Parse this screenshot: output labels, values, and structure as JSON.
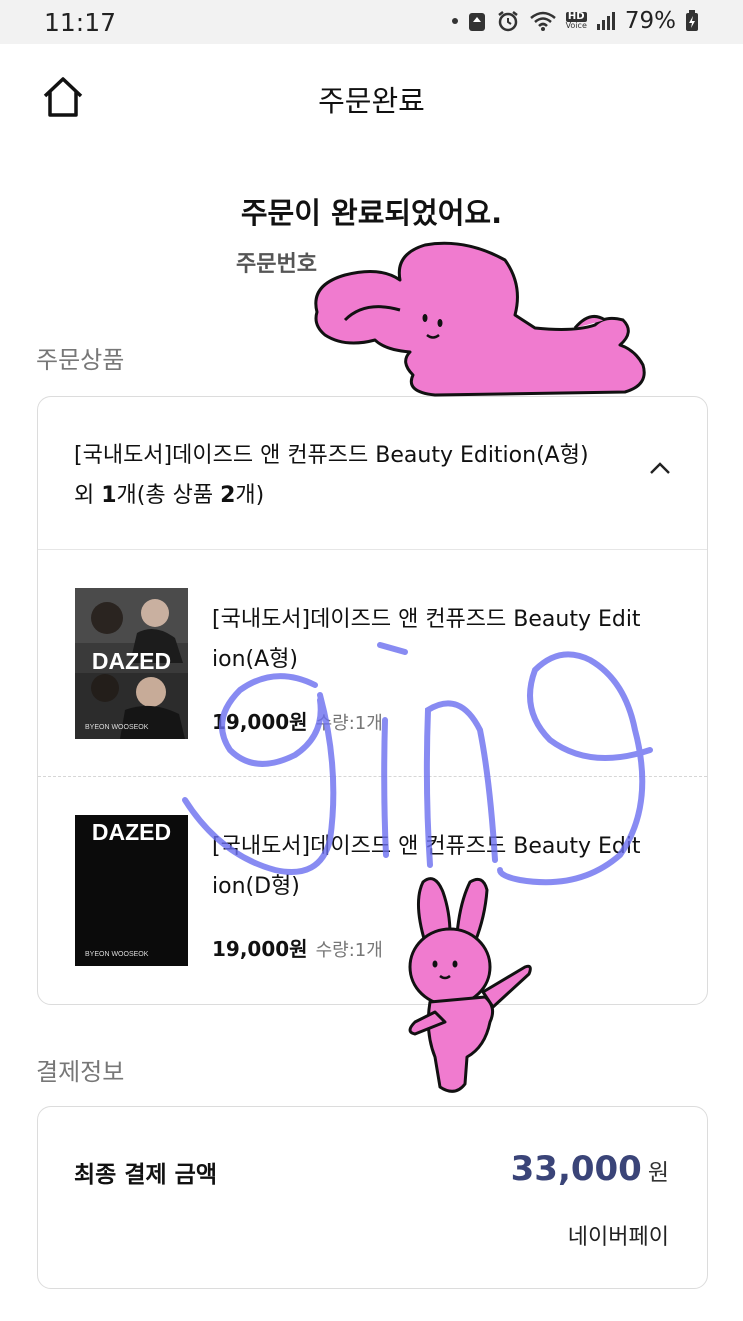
{
  "status_bar": {
    "time": "11:17",
    "hd_label": "HD",
    "voice_label": "Voice",
    "battery": "79%"
  },
  "header": {
    "title": "주문완료"
  },
  "complete": {
    "title": "주문이 완료되었어요.",
    "order_number_label": "주문번호 "
  },
  "products": {
    "section_label": "주문상품",
    "summary_title": "[국내도서]데이즈드 앤 컨퓨즈드 Beauty Edition(A형)",
    "summary_prefix": "외 ",
    "summary_extra_count": "1",
    "summary_mid": "개(총 상품 ",
    "summary_total_count": "2",
    "summary_suffix": "개)",
    "items": [
      {
        "title_line1": "[국내도서]데이즈드 앤 컨퓨즈드 Beauty Edit",
        "title_line2": "ion(A형)",
        "price": "19,000원",
        "qty": "수량:1개",
        "cover_word": "DAZED",
        "cover_small": "BYEON WOOSEOK"
      },
      {
        "title_line1": "[국내도서]데이즈드 앤 컨퓨즈드 Beauty Edit",
        "title_line2": "ion(D형)",
        "price": "19,000원",
        "qty": "수량:1개",
        "cover_word": "DAZED",
        "cover_small": "BYEON WOOSEOK"
      }
    ]
  },
  "payment": {
    "section_label": "결제정보",
    "final_label": "최종 결제 금액",
    "amount": "33,000",
    "unit": "원",
    "method": "네이버페이"
  },
  "colors": {
    "amount": "#3a4478",
    "sticker_pink": "#f07bcf",
    "scribble": "#6b6ff0"
  },
  "icons": [
    "home-icon",
    "chevron-up-icon",
    "wifi-icon",
    "signal-icon",
    "battery-icon",
    "alarm-icon"
  ]
}
